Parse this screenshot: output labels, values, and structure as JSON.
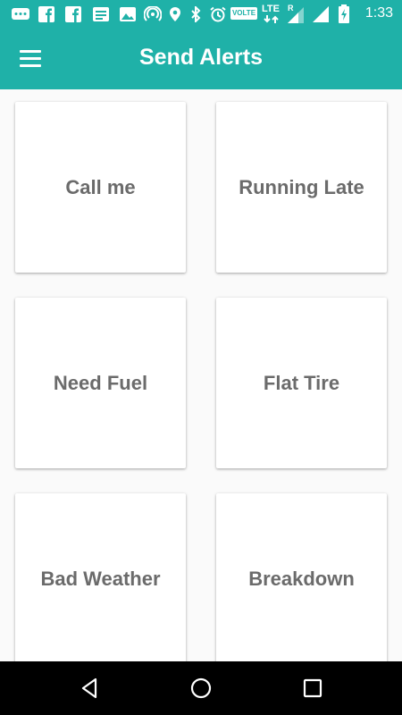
{
  "status_bar": {
    "time": "1:33",
    "icons": [
      "chat-icon",
      "facebook-icon",
      "facebook-icon",
      "news-icon",
      "image-icon",
      "hotspot-icon",
      "location-icon",
      "bluetooth-icon",
      "alarm-icon",
      "volte-badge",
      "lte-icon",
      "signal-icon",
      "signal-icon",
      "battery-charging-icon"
    ],
    "volte_label": "VOLTE",
    "lte_label": "LTE",
    "roaming_label": "R"
  },
  "app_bar": {
    "title": "Send Alerts",
    "menu_icon": "hamburger-menu-icon"
  },
  "alerts": [
    {
      "label": "Call me"
    },
    {
      "label": "Running Late"
    },
    {
      "label": "Need Fuel"
    },
    {
      "label": "Flat Tire"
    },
    {
      "label": "Bad Weather"
    },
    {
      "label": "Breakdown"
    }
  ],
  "nav_bar": {
    "icons": [
      "back-icon",
      "home-icon",
      "recents-icon"
    ]
  },
  "colors": {
    "primary": "#1fb1a8",
    "card_text": "#6b6b6b",
    "background": "#fafafa"
  }
}
